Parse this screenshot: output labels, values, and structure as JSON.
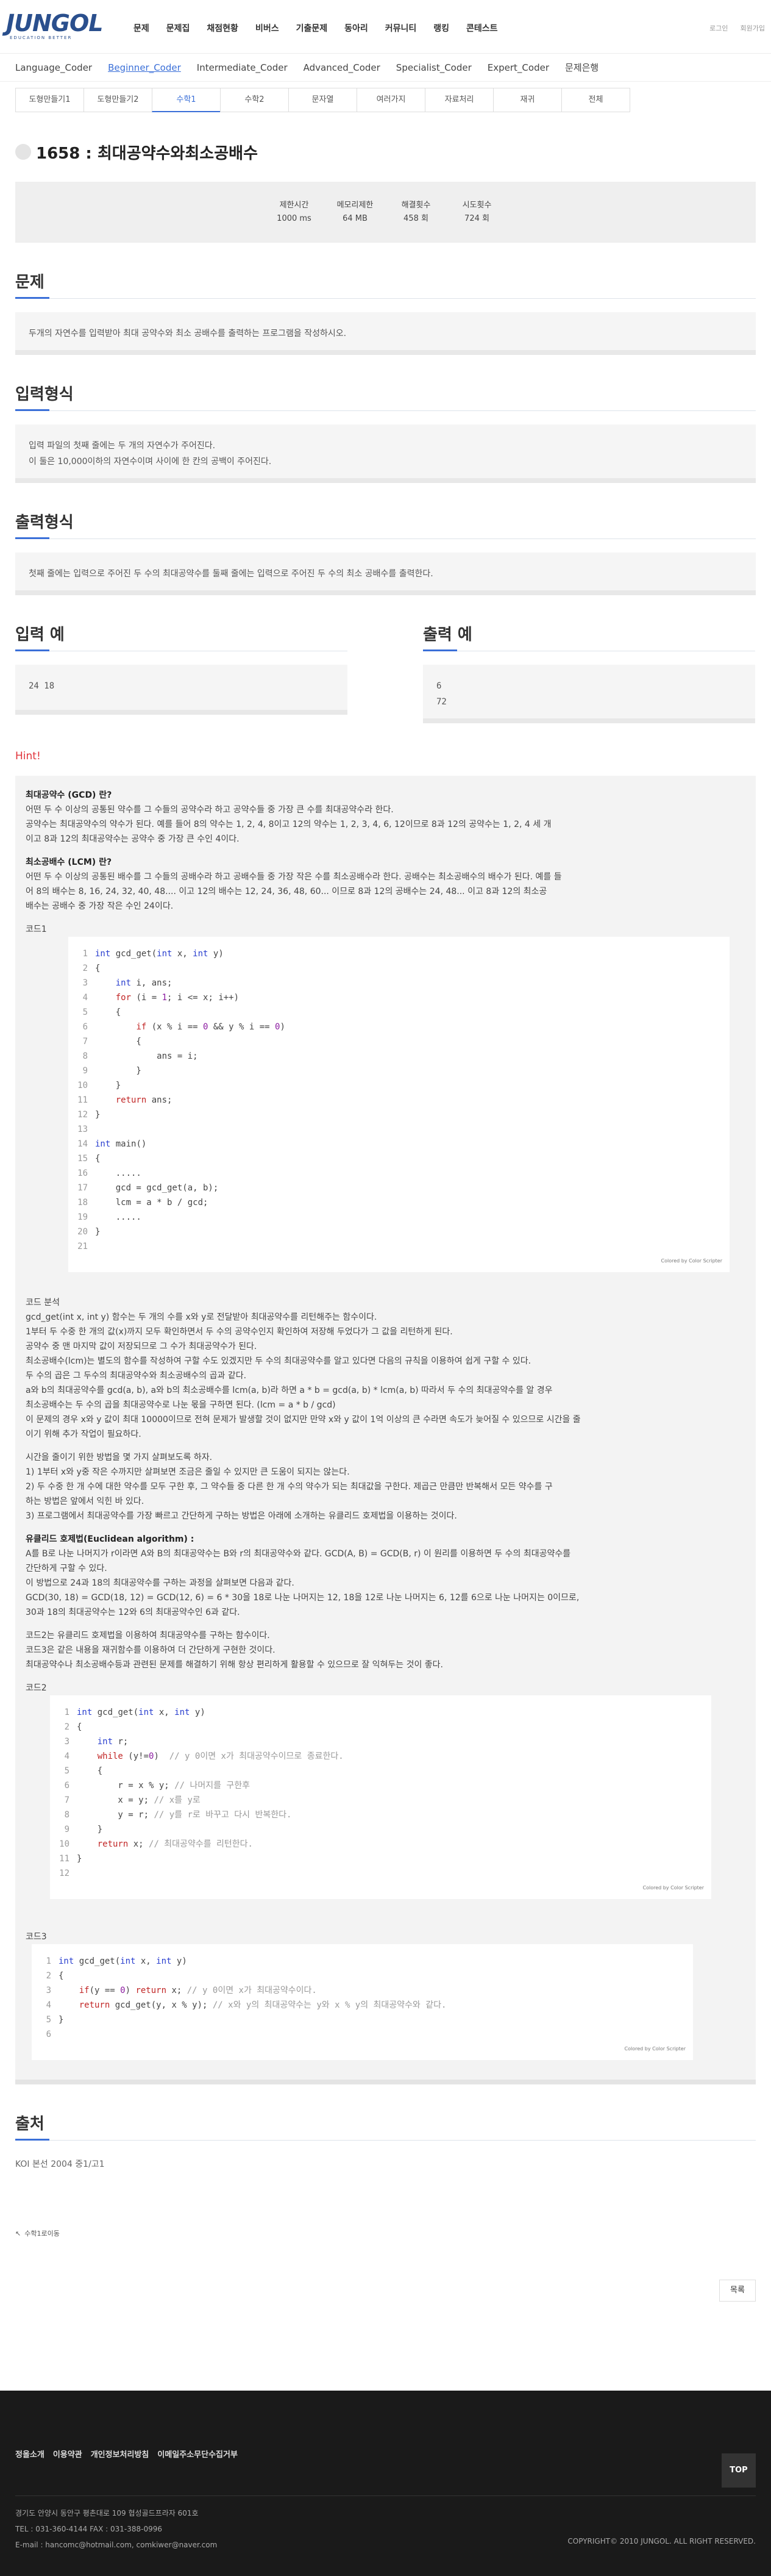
{
  "brand": {
    "logo": "JUNGOL",
    "sub": "EDUCATION BETTER"
  },
  "gnb": [
    "문제",
    "문제집",
    "채점현황",
    "비버스",
    "기출문제",
    "동아리",
    "커뮤니티",
    "랭킹",
    "콘테스트"
  ],
  "util": [
    "로그인",
    "회원가입"
  ],
  "subnav": [
    "Language_Coder",
    "Beginner_Coder",
    "Intermediate_Coder",
    "Advanced_Coder",
    "Specialist_Coder",
    "Expert_Coder",
    "문제은행"
  ],
  "subnav_active": "Beginner_Coder",
  "tabs": [
    "도형만들기1",
    "도형만들기2",
    "수학1",
    "수학2",
    "문자열",
    "여러가지",
    "자료처리",
    "재귀",
    "전체"
  ],
  "tab_active": "수학1",
  "problem": {
    "title": "1658 : 최대공약수와최소공배수",
    "limits": [
      {
        "label": "제한시간",
        "value": "1000 ms"
      },
      {
        "label": "메모리제한",
        "value": "64 MB"
      },
      {
        "label": "해결횟수",
        "value": "458 회"
      },
      {
        "label": "시도횟수",
        "value": "724 회"
      }
    ],
    "sections": {
      "problem_h": "문제",
      "problem_text": "두개의 자연수를 입력받아 최대 공약수와 최소 공배수를 출력하는 프로그램을 작성하시오.",
      "input_h": "입력형식",
      "input_text1": "입력 파일의 첫째 줄에는 두 개의 자연수가 주어진다.",
      "input_text2": "이 둘은 10,000이하의 자연수이며 사이에 한 칸의 공백이 주어진다.",
      "output_h": "출력형식",
      "output_text": "첫째 줄에는 입력으로 주어진 두 수의 최대공약수를 둘째 줄에는 입력으로 주어진 두 수의 최소 공배수를 출력한다.",
      "input_ex_h": "입력 예",
      "input_ex": "24 18",
      "output_ex_h": "출력 예",
      "output_ex1": "6",
      "output_ex2": "72"
    }
  },
  "hint": {
    "label": "Hint!",
    "gcd_title": "최대공약수 (GCD) 란?",
    "gcd_1": "어떤 두 수 이상의 공통된 약수를 그 수들의 공약수라 하고 공약수들 중 가장 큰 수를 최대공약수라 한다.",
    "gcd_2": "공약수는 최대공약수의 약수가 된다. 예를 들어 8의 약수는 1, 2, 4, 8이고 12의 약수는 1, 2, 3, 4, 6, 12이므로 8과 12의 공약수는 1, 2, 4 세 개",
    "gcd_3": "이고 8과 12의 최대공약수는 공약수 중 가장 큰 수인 4이다.",
    "lcm_title": "최소공배수 (LCM) 란?",
    "lcm_1": "어떤 두 수 이상의 공통된 배수를 그 수들의 공배수라 하고 공배수들 중 가장 작은 수를 최소공배수라 한다. 공배수는 최소공배수의 배수가 된다. 예를 들",
    "lcm_2": "어 8의 배수는 8, 16, 24, 32, 40, 48.... 이고 12의 배수는 12, 24, 36, 48, 60... 이므로 8과 12의 공배수는 24, 48... 이고 8과 12의 최소공",
    "lcm_3": "배수는 공배수 중 가장 작은 수인 24이다.",
    "code1_label": "코드1",
    "code2_label": "코드2",
    "code3_label": "코드3",
    "credit": "Colored by Color Scripter",
    "analysis_title": "코드 분석",
    "analysis": [
      "gcd_get(int x, int y) 함수는 두 개의 수를 x와 y로 전달받아 최대공약수를 리턴해주는 함수이다.",
      "1부터 두 수중 한 개의 값(x)까지 모두 확인하면서 두 수의 공약수인지 확인하여 저장해 두었다가 그 값을 리턴하게 된다.",
      "공약수 중 맨 마지막 값이 저장되므로 그 수가 최대공약수가 된다.",
      "최소공배수(lcm)는 별도의 함수를 작성하여 구할 수도 있겠지만 두 수의 최대공약수를 알고 있다면 다음의 규칙을 이용하여 쉽게 구할 수 있다.",
      "두 수의 곱은 그 두수의 최대공약수와 최소공배수의 곱과 같다.",
      "a와 b의 최대공약수를 gcd(a, b), a와 b의 최소공배수를 lcm(a, b)라 하면 a * b = gcd(a, b) * lcm(a, b) 따라서 두 수의 최대공약수를 알 경우",
      "최소공배수는 두 수의 곱을 최대공약수로 나눈 몫을 구하면 된다. (lcm = a * b / gcd)",
      "이 문제의 경우 x와 y 값이 최대 10000이므로 전혀 문제가 발생할 것이 없지만 만약 x와 y 값이 1억 이상의 큰 수라면 속도가 늦어질 수 있으므로 시간을 줄",
      "이기 위해 추가 작업이 필요하다."
    ],
    "reduce_title": "시간을 줄이기 위한 방법을 몇 가지 살펴보도록 하자.",
    "reduce": [
      "1) 1부터 x와 y중 작은 수까지만 살펴보면 조금은 줄일 수 있지만 큰 도움이 되지는 않는다.",
      "2) 두 수중 한 개 수에 대한 약수를 모두 구한 후, 그 약수들 중 다른 한 개 수의 약수가 되는 최대값을 구한다. 제곱근 만큼만 반복해서 모든 약수를 구",
      "하는 방법은 앞에서 익힌 바 있다.",
      "3) 프로그램에서 최대공약수를 가장 빠르고 간단하게 구하는 방법은 아래에 소개하는 유클리드 호제법을 이용하는 것이다."
    ],
    "euclid_title": "유클리드 호제법(Euclidean algorithm) :",
    "euclid": [
      "A를 B로 나눈 나머지가 r이라면 A와 B의 최대공약수는 B와 r의 최대공약수와 같다. GCD(A, B) = GCD(B, r) 이 원리를 이용하면 두 수의 최대공약수를",
      "간단하게 구할 수 있다.",
      "이 방법으로 24과 18의 최대공약수를 구하는 과정을 살펴보면 다음과 같다.",
      "GCD(30, 18) = GCD(18, 12) = GCD(12, 6) = 6 * 30을 18로 나눈 나머지는 12, 18을 12로 나눈 나머지는 6, 12를 6으로 나눈 나머지는 0이므로,",
      "30과 18의 최대공약수는 12와 6의 최대공약수인 6과 같다."
    ],
    "closing": [
      "코드2는 유클리드 호제법을 이용하여 최대공약수를 구하는 함수이다.",
      "코드3은 같은 내용을 재귀함수를 이용하여 더 간단하게 구현한 것이다.",
      "최대공약수나 최소공배수등과 관련된 문제를 해결하기 위해 항상 편리하게 활용할 수 있으므로 잘 익혀두는 것이 좋다."
    ]
  },
  "source": {
    "heading": "출처",
    "text": "KOI 본선 2004 중1/고1"
  },
  "back_link": "수학1로이동",
  "list_button": "목록",
  "footer": {
    "links": [
      "정올소개",
      "이용약관",
      "개인정보처리방침",
      "이메일주소무단수집거부"
    ],
    "top": "TOP",
    "addr": "경기도 안양시 동안구 평촌대로 109 협성골드프라자 601호",
    "tel": "TEL : 031-360-4144     FAX : 031-388-0996",
    "email": "E-mail : hancomc@hotmail.com, comkiwer@naver.com",
    "copyright": "COPYRIGHT© 2010 JUNGOL. ALL RIGHT RESERVED."
  }
}
